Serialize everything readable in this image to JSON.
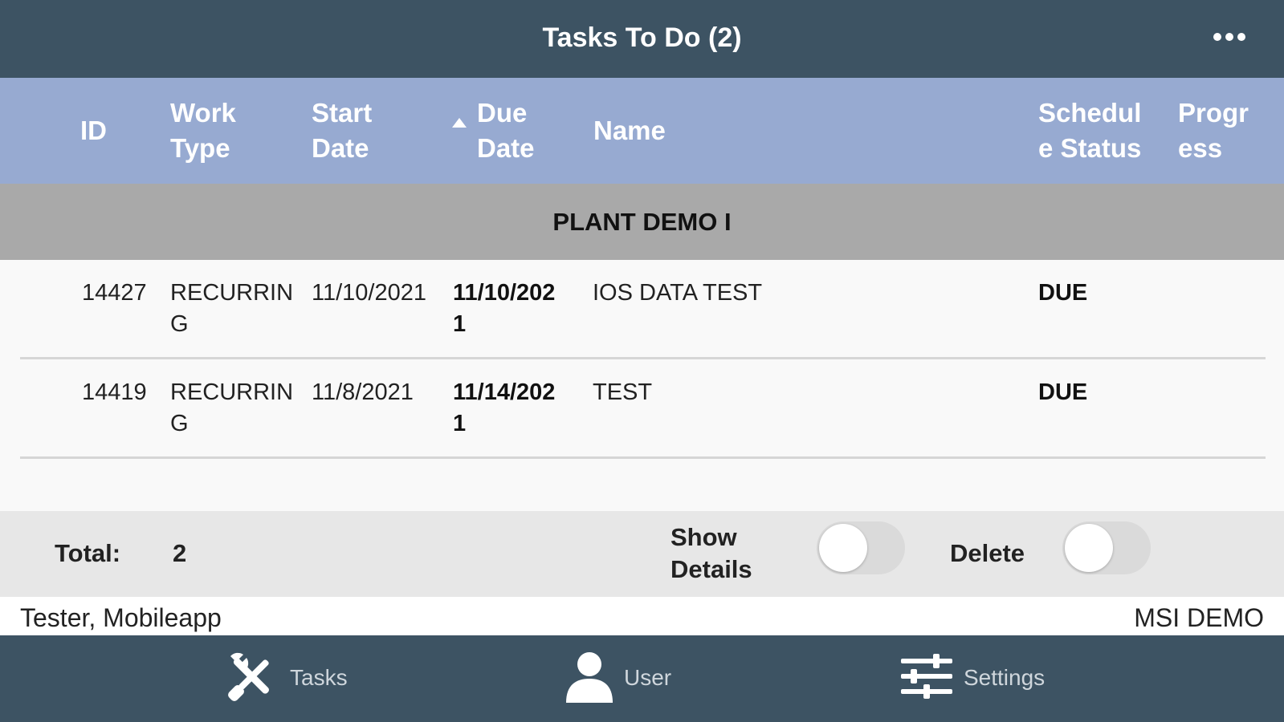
{
  "header": {
    "title": "Tasks To Do (2)",
    "more_icon": "more-horizontal-icon"
  },
  "columns": {
    "id": "ID",
    "work_type_1": "Work",
    "work_type_2": "Type",
    "start_date_1": "Start",
    "start_date_2": "Date",
    "due_date_1": "Due",
    "due_date_2": "Date",
    "name": "Name",
    "schedule_status_1": "Schedul",
    "schedule_status_2": "e Status",
    "progress_1": "Progr",
    "progress_2": "ess",
    "sort_icon": "sort-ascending-icon"
  },
  "group": {
    "label": "PLANT DEMO I"
  },
  "rows": [
    {
      "id": "14427",
      "work_type_1": "RECURRIN",
      "work_type_2": "G",
      "start_date": "11/10/2021",
      "due_date_1": "11/10/202",
      "due_date_2": "1",
      "name": "IOS DATA TEST",
      "status": "DUE"
    },
    {
      "id": "14419",
      "work_type_1": "RECURRIN",
      "work_type_2": "G",
      "start_date": "11/8/2021",
      "due_date_1": "11/14/202",
      "due_date_2": "1",
      "name": "TEST",
      "status": "DUE"
    }
  ],
  "footer": {
    "total_label": "Total:",
    "total_value": "2",
    "show_details_1": "Show",
    "show_details_2": "Details",
    "show_details_on": false,
    "delete_label": "Delete",
    "delete_on": false
  },
  "status_line": {
    "user": "Tester, Mobileapp",
    "site": "MSI DEMO"
  },
  "tabs": [
    {
      "label": "Tasks",
      "icon": "tools-icon"
    },
    {
      "label": "User",
      "icon": "user-icon"
    },
    {
      "label": "Settings",
      "icon": "sliders-icon"
    }
  ],
  "colors": {
    "header_bg": "#3d5363",
    "column_header_bg": "#97aad1",
    "group_bg": "#a9a9a9",
    "footer_bg": "#e7e7e7",
    "toggle_off": "#dadada"
  }
}
